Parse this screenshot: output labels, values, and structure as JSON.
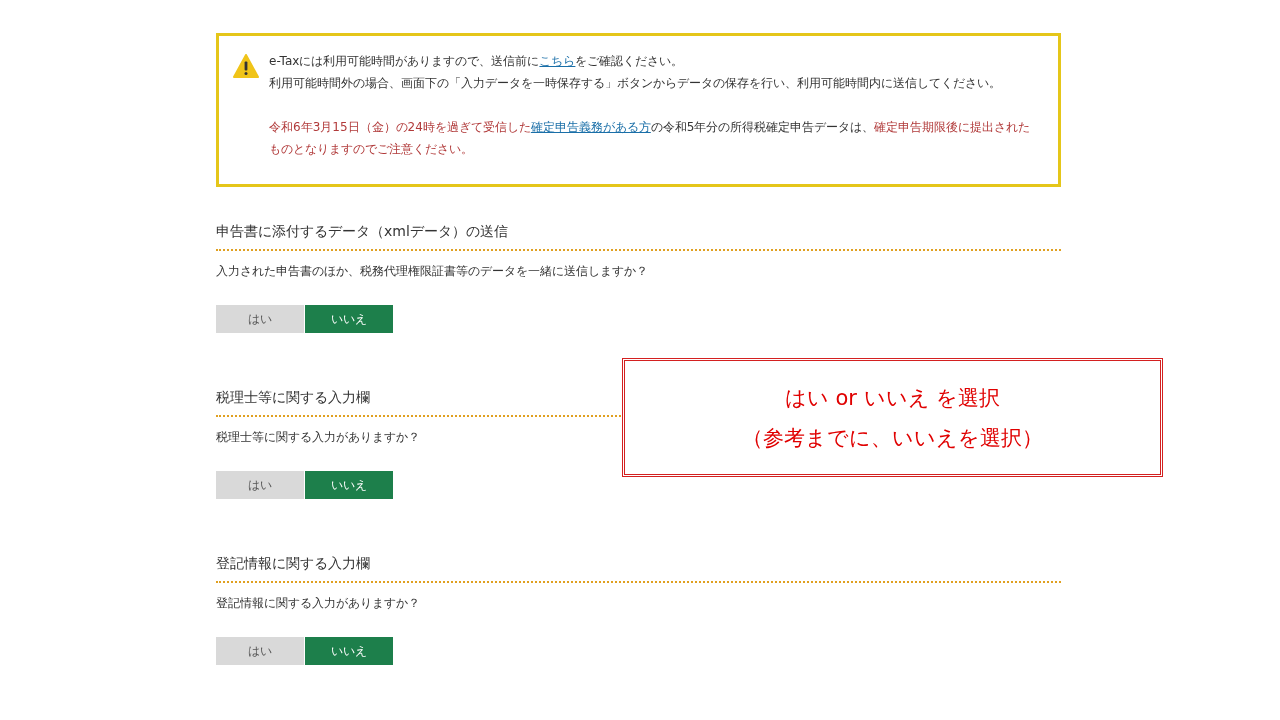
{
  "notice": {
    "paragraphs": [
      {
        "segments": [
          {
            "kind": "plain",
            "text": "e-Taxには利用可能時間がありますので、送信前に"
          },
          {
            "kind": "link",
            "text": "こちら"
          },
          {
            "kind": "plain",
            "text": "をご確認ください。"
          }
        ]
      },
      {
        "segments": [
          {
            "kind": "plain",
            "text": "利用可能時間外の場合、画面下の「入力データを一時保存する」ボタンからデータの保存を行い、利用可能時間内に送信してください。"
          }
        ]
      },
      {
        "segments": [
          {
            "kind": "alert",
            "text": "令和6年3月15日（金）の24時を過ぎて受信した"
          },
          {
            "kind": "link",
            "text": "確定申告義務がある方"
          },
          {
            "kind": "plain",
            "text": "の令和5年分の所得税確定申告データは、"
          },
          {
            "kind": "alert",
            "text": "確定申告期限後に提出されたものとなりますのでご注意ください。"
          }
        ]
      }
    ]
  },
  "sections": [
    {
      "heading": "申告書に添付するデータ（xmlデータ）の送信",
      "question": "入力された申告書のほか、税務代理権限証書等のデータを一緒に送信しますか？",
      "options": [
        {
          "label": "はい",
          "selected": false
        },
        {
          "label": "いいえ",
          "selected": true
        }
      ]
    },
    {
      "heading": "税理士等に関する入力欄",
      "question": "税理士等に関する入力がありますか？",
      "options": [
        {
          "label": "はい",
          "selected": false
        },
        {
          "label": "いいえ",
          "selected": true
        }
      ]
    },
    {
      "heading": "登記情報に関する入力欄",
      "question": "登記情報に関する入力がありますか？",
      "options": [
        {
          "label": "はい",
          "selected": false
        },
        {
          "label": "いいえ",
          "selected": true
        }
      ]
    }
  ],
  "callout": {
    "lines": [
      "はい or いいえ を選択",
      "（参考までに、いいえを選択）"
    ]
  }
}
